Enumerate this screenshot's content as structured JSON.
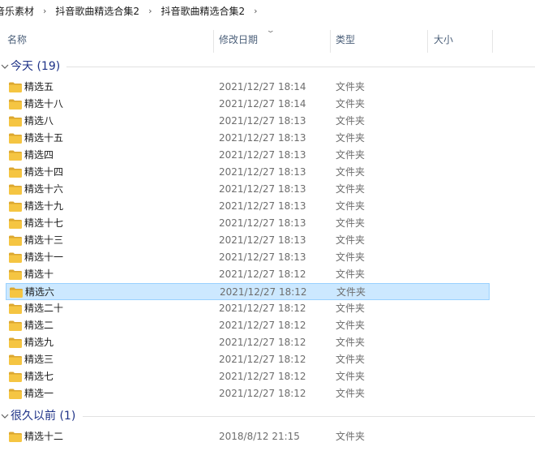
{
  "breadcrumb": {
    "items": [
      "音乐素材",
      "抖音歌曲精选合集2",
      "抖音歌曲精选合集2"
    ],
    "separator": "›"
  },
  "columns": {
    "name": "名称",
    "modified": "修改日期",
    "type": "类型",
    "size": "大小"
  },
  "groups": [
    {
      "title": "今天 (19)",
      "items": [
        {
          "name": "精选五",
          "date": "2021/12/27 18:14",
          "type": "文件夹"
        },
        {
          "name": "精选十八",
          "date": "2021/12/27 18:14",
          "type": "文件夹"
        },
        {
          "name": "精选八",
          "date": "2021/12/27 18:13",
          "type": "文件夹"
        },
        {
          "name": "精选十五",
          "date": "2021/12/27 18:13",
          "type": "文件夹"
        },
        {
          "name": "精选四",
          "date": "2021/12/27 18:13",
          "type": "文件夹"
        },
        {
          "name": "精选十四",
          "date": "2021/12/27 18:13",
          "type": "文件夹"
        },
        {
          "name": "精选十六",
          "date": "2021/12/27 18:13",
          "type": "文件夹"
        },
        {
          "name": "精选十九",
          "date": "2021/12/27 18:13",
          "type": "文件夹"
        },
        {
          "name": "精选十七",
          "date": "2021/12/27 18:13",
          "type": "文件夹"
        },
        {
          "name": "精选十三",
          "date": "2021/12/27 18:13",
          "type": "文件夹"
        },
        {
          "name": "精选十一",
          "date": "2021/12/27 18:13",
          "type": "文件夹"
        },
        {
          "name": "精选十",
          "date": "2021/12/27 18:12",
          "type": "文件夹"
        },
        {
          "name": "精选六",
          "date": "2021/12/27 18:12",
          "type": "文件夹",
          "selected": true
        },
        {
          "name": "精选二十",
          "date": "2021/12/27 18:12",
          "type": "文件夹"
        },
        {
          "name": "精选二",
          "date": "2021/12/27 18:12",
          "type": "文件夹"
        },
        {
          "name": "精选九",
          "date": "2021/12/27 18:12",
          "type": "文件夹"
        },
        {
          "name": "精选三",
          "date": "2021/12/27 18:12",
          "type": "文件夹"
        },
        {
          "name": "精选七",
          "date": "2021/12/27 18:12",
          "type": "文件夹"
        },
        {
          "name": "精选一",
          "date": "2021/12/27 18:12",
          "type": "文件夹"
        }
      ]
    },
    {
      "title": "很久以前 (1)",
      "items": [
        {
          "name": "精选十二",
          "date": "2018/8/12 21:15",
          "type": "文件夹"
        }
      ]
    }
  ],
  "colors": {
    "folder": "#f5c542",
    "selection_bg": "#cce8ff",
    "selection_border": "#99d1ff",
    "group_title": "#1e3287",
    "column_header": "#4c607a"
  },
  "icons": {
    "folder": "folder-icon",
    "chevron": "chevron-down-icon",
    "separator": "breadcrumb-separator-icon"
  }
}
